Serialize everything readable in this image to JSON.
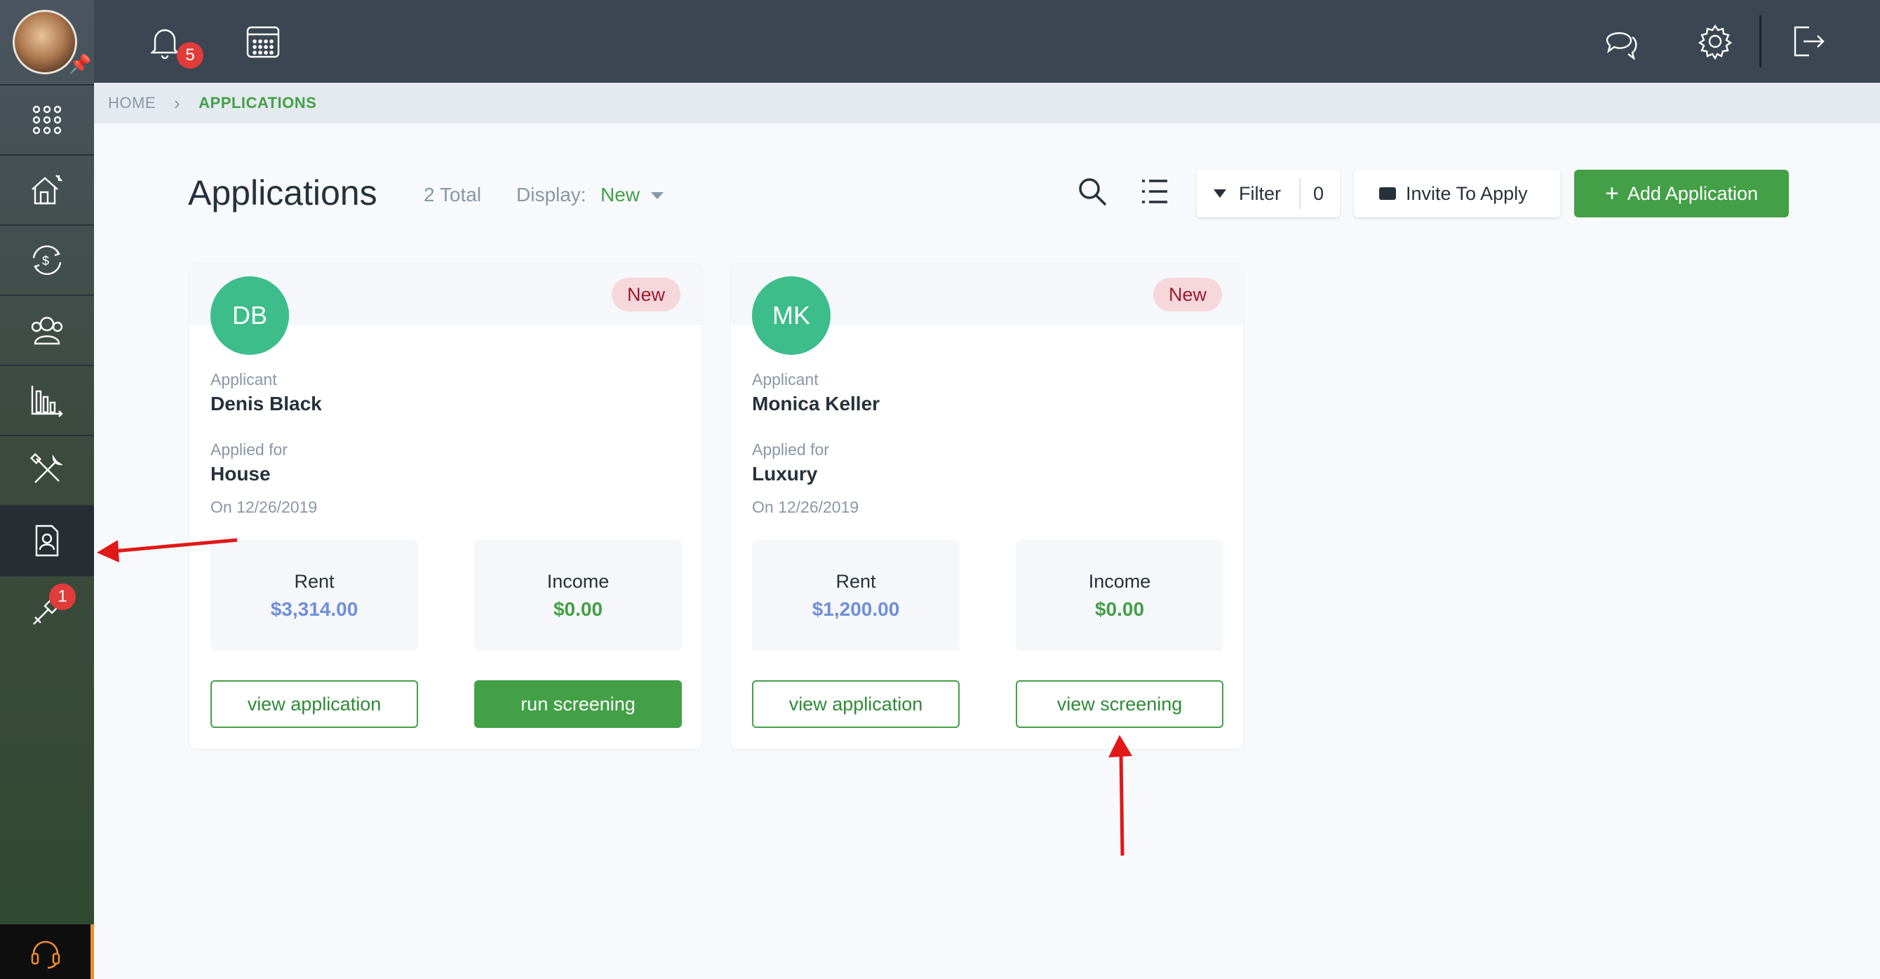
{
  "topbar": {
    "notifications_count": "5",
    "icons": [
      "bell-icon",
      "calendar-icon",
      "chat-icon",
      "gear-icon",
      "logout-icon"
    ]
  },
  "sidebar": {
    "items": [
      {
        "icon": "apps-grid-icon"
      },
      {
        "icon": "properties-icon"
      },
      {
        "icon": "accounting-icon"
      },
      {
        "icon": "people-icon"
      },
      {
        "icon": "reports-icon"
      },
      {
        "icon": "maintenance-icon"
      },
      {
        "icon": "applications-icon",
        "active": true
      },
      {
        "icon": "tools-icon",
        "badge": "1"
      }
    ],
    "support_icon": "headset-icon"
  },
  "breadcrumb": {
    "home": "HOME",
    "current": "APPLICATIONS"
  },
  "header": {
    "title": "Applications",
    "total": "2 Total",
    "display_label": "Display:",
    "display_value": "New",
    "filter_label": "Filter",
    "filter_count": "0",
    "invite_label": "Invite To Apply",
    "add_label": "Add Application",
    "add_plus": "+"
  },
  "cards": [
    {
      "initials": "DB",
      "status": "New",
      "applicant_label": "Applicant",
      "applicant_name": "Denis Black",
      "applied_for_label": "Applied for",
      "applied_for": "House",
      "date": "On 12/26/2019",
      "rent_label": "Rent",
      "rent_value": "$3,314.00",
      "income_label": "Income",
      "income_value": "$0.00",
      "primary_button": "view application",
      "secondary_button": "run screening"
    },
    {
      "initials": "MK",
      "status": "New",
      "applicant_label": "Applicant",
      "applicant_name": "Monica Keller",
      "applied_for_label": "Applied for",
      "applied_for": "Luxury",
      "date": "On 12/26/2019",
      "rent_label": "Rent",
      "rent_value": "$1,200.00",
      "income_label": "Income",
      "income_value": "$0.00",
      "primary_button": "view application",
      "secondary_button": "view screening"
    }
  ],
  "colors": {
    "accent": "#43a047",
    "annotation_arrow": "#e01818",
    "badge": "#e03c3c"
  }
}
